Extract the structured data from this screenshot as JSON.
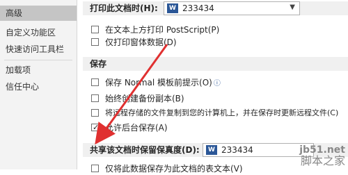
{
  "sidebar": {
    "items": [
      {
        "label": "高级",
        "selected": true
      },
      {
        "label": "自定义功能区",
        "selected": false
      },
      {
        "label": "快速访问工具栏",
        "selected": false
      },
      {
        "label": "加载项",
        "selected": false
      },
      {
        "label": "信任中心",
        "selected": false
      }
    ]
  },
  "print_doc": {
    "label": "打印此文档时(H):",
    "selected": "233434"
  },
  "print_options": [
    {
      "label": "在文本上方打印 PostScript(P)",
      "checked": false
    },
    {
      "label": "仅打印窗体数据(D)",
      "checked": false
    }
  ],
  "save": {
    "header": "保存",
    "options": [
      {
        "label": "保存 Normal 模板前提示(O)",
        "checked": false
      },
      {
        "label": "始终创建备份副本(B)",
        "checked": false
      },
      {
        "label": "将远程存储的文件复制到您的计算机上，并在保存时更新远程文件(C)",
        "checked": false
      },
      {
        "label": "允许后台保存(A)",
        "checked": true
      }
    ]
  },
  "share": {
    "label": "共享该文档时保留保真度(D):",
    "selected": "233434",
    "partial_option": "仅将此数据保存为此文档的表文本(V)"
  },
  "watermark": {
    "url": "jb51.net",
    "name": "脚本之家"
  },
  "icons": {
    "doc": "word-document-icon",
    "dropdown": "chevron-down-icon",
    "info": "info-icon",
    "arrow": "red-annotation-arrow"
  },
  "colors": {
    "accent": "#2b5797",
    "selected_sidebar": "#c5c5c5",
    "arrow": "#e03030"
  }
}
